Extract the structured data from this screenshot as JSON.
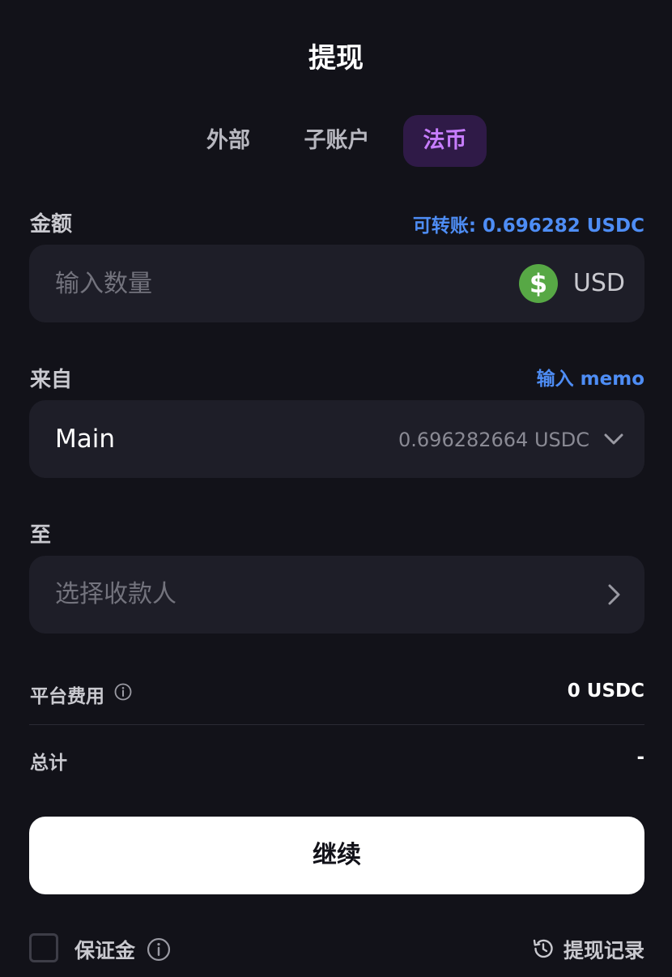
{
  "header": {
    "title": "提现"
  },
  "tabs": [
    {
      "label": "外部",
      "active": false
    },
    {
      "label": "子账户",
      "active": false
    },
    {
      "label": "法币",
      "active": true
    }
  ],
  "amount": {
    "label": "金额",
    "available": "可转账: 0.696282 USDC",
    "placeholder": "输入数量",
    "currency_icon": "dollar-coin-icon",
    "currency_symbol": "$",
    "currency": "USD"
  },
  "from": {
    "label": "来自",
    "memo_link": "输入 memo",
    "account": "Main",
    "balance": "0.696282664 USDC",
    "icon": "chevron-down-icon"
  },
  "to": {
    "label": "至",
    "placeholder": "选择收款人",
    "icon": "chevron-right-icon"
  },
  "fees": {
    "platform_fee_label": "平台费用",
    "platform_fee_value": "0 USDC",
    "total_label": "总计",
    "total_value": "-"
  },
  "actions": {
    "continue_label": "继续"
  },
  "footer": {
    "margin_label": "保证金",
    "margin_checked": false,
    "history_label": "提现记录"
  },
  "colors": {
    "background": "#121219",
    "field_bg": "#1e1e28",
    "accent_purple": "#c77dff",
    "accent_blue": "#4e8df5",
    "coin_green": "#57a845"
  }
}
